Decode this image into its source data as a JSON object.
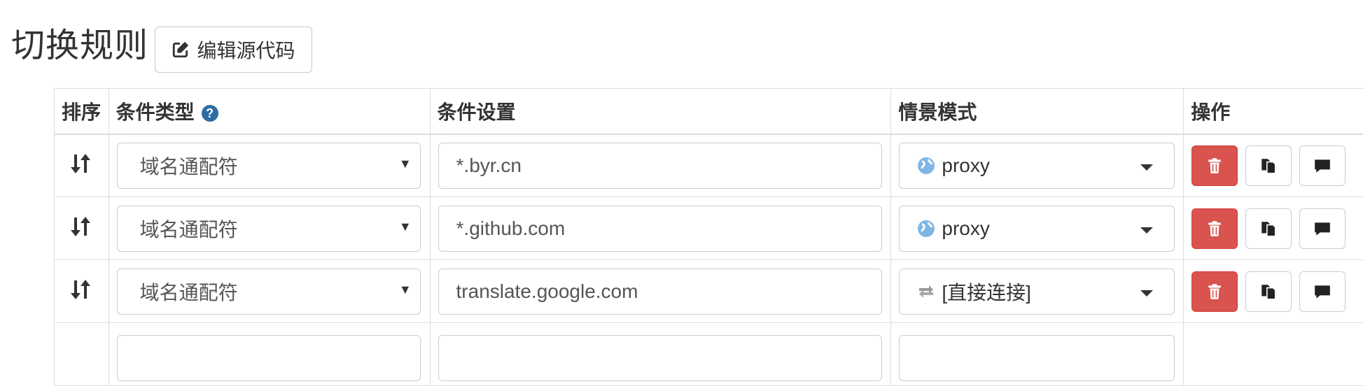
{
  "header": {
    "title": "切换规则",
    "edit_source_label": "编辑源代码"
  },
  "table": {
    "columns": {
      "sort": "排序",
      "condition_type": "条件类型",
      "condition_setting": "条件设置",
      "profile": "情景模式",
      "actions": "操作"
    },
    "rows": [
      {
        "condition_type": "域名通配符",
        "condition_setting": "*.byr.cn",
        "profile": "proxy",
        "profile_icon": "globe-icon"
      },
      {
        "condition_type": "域名通配符",
        "condition_setting": "*.github.com",
        "profile": "proxy",
        "profile_icon": "globe-icon"
      },
      {
        "condition_type": "域名通配符",
        "condition_setting": "translate.google.com",
        "profile": "[直接连接]",
        "profile_icon": "transfer-icon"
      }
    ]
  },
  "colors": {
    "danger": "#d9534f",
    "help": "#2e6da4",
    "globe": "#7fb6e6",
    "transfer": "#999999"
  }
}
